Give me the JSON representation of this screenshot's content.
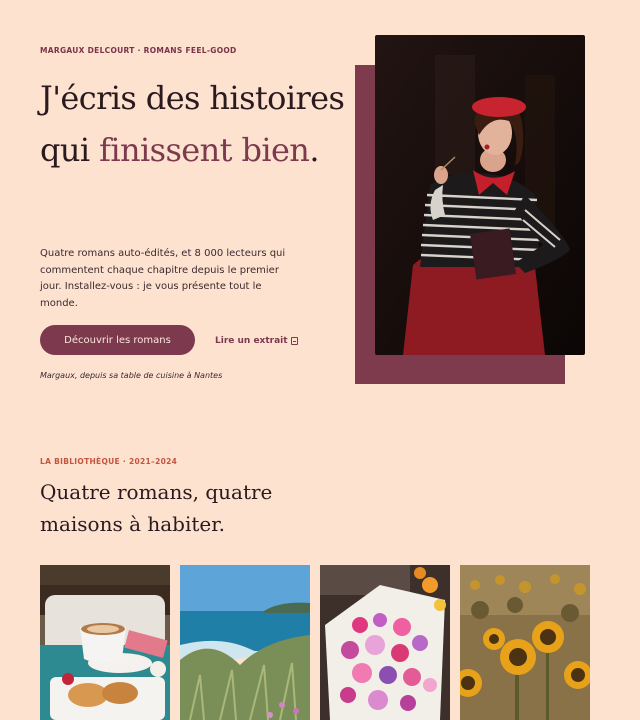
{
  "header": {
    "eyebrow": "MARGAUX DELCOURT · ROMANS FEEL-GOOD"
  },
  "hero": {
    "title_line1": "J'écris des histoires",
    "title_line2_prefix": "qui ",
    "title_line2_accent": "finissent bien",
    "title_line2_suffix": ".",
    "intro": "Quatre romans auto-édités, et 8 000 lecteurs qui commentent chaque chapitre depuis le premier jour. Installez-vous : je vous présente tout le monde.",
    "cta_label": "Découvrir les romans",
    "link_label": "Lire un extrait",
    "caption": "Margaux, depuis sa table de cuisine à Nantes"
  },
  "library": {
    "eyebrow": "LA BIBLIOTHÈQUE · 2021–2024",
    "title": "Quatre romans, quatre maisons à habiter."
  },
  "colors": {
    "background": "#fde2d0",
    "accent": "#7d3a4e",
    "eyebrow_secondary": "#c4553f",
    "text": "#2a1a1f"
  },
  "icons": {
    "link_icon": "book-icon"
  }
}
